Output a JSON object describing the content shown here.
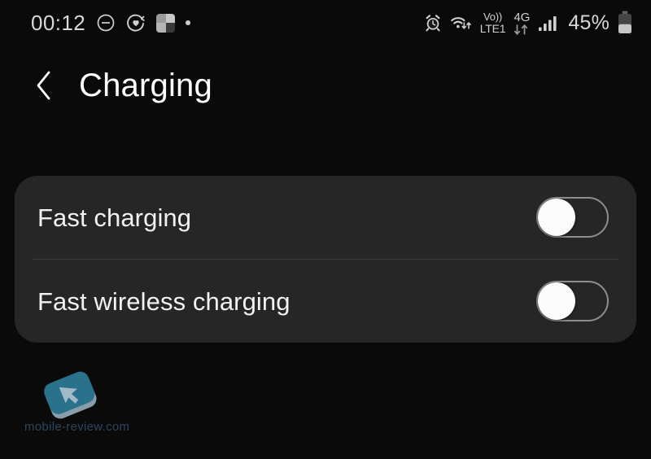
{
  "status_bar": {
    "time": "00:12",
    "left_icons": [
      {
        "name": "do-not-disturb-icon",
        "glyph": "minus-circle"
      },
      {
        "name": "health-heart-icon",
        "glyph": "heart-circle"
      },
      {
        "name": "multi-window-icon",
        "glyph": "quad-square"
      },
      {
        "name": "notification-dot-icon",
        "glyph": "dot"
      }
    ],
    "right_icons": [
      {
        "name": "alarm-icon",
        "glyph": "alarm-clock"
      },
      {
        "name": "wifi-icon",
        "glyph": "wifi-with-transfer-arrows"
      },
      {
        "name": "volte-icon",
        "label_top": "Vo))",
        "label_bottom": "LTE1"
      },
      {
        "name": "mobile-network-icon",
        "label": "4G",
        "glyph": "data-transfer-arrows"
      },
      {
        "name": "signal-bars-icon",
        "glyph": "signal-4-bars"
      }
    ],
    "battery_percent_label": "45%",
    "battery_level": 45
  },
  "header": {
    "back_icon": "chevron-left-icon",
    "title": "Charging"
  },
  "settings": {
    "rows": [
      {
        "id": "fast-charging",
        "label": "Fast charging",
        "toggle_state": "off",
        "toggle_name": "fast-charging-toggle"
      },
      {
        "id": "fast-wireless-charging",
        "label": "Fast wireless charging",
        "toggle_state": "off",
        "toggle_name": "fast-wireless-charging-toggle"
      }
    ]
  },
  "watermark": {
    "text": "mobile-review.com",
    "logo_color": "#2c7794",
    "text_color": "#2d4a63"
  },
  "colors": {
    "page_background": "#0a0a0a",
    "card_background": "#262626",
    "divider": "#3d3d3d",
    "primary_text": "#ffffff",
    "status_text": "#d8d8d8",
    "toggle_track_off": "#8e8e8e",
    "toggle_knob": "#fbfbfb"
  }
}
